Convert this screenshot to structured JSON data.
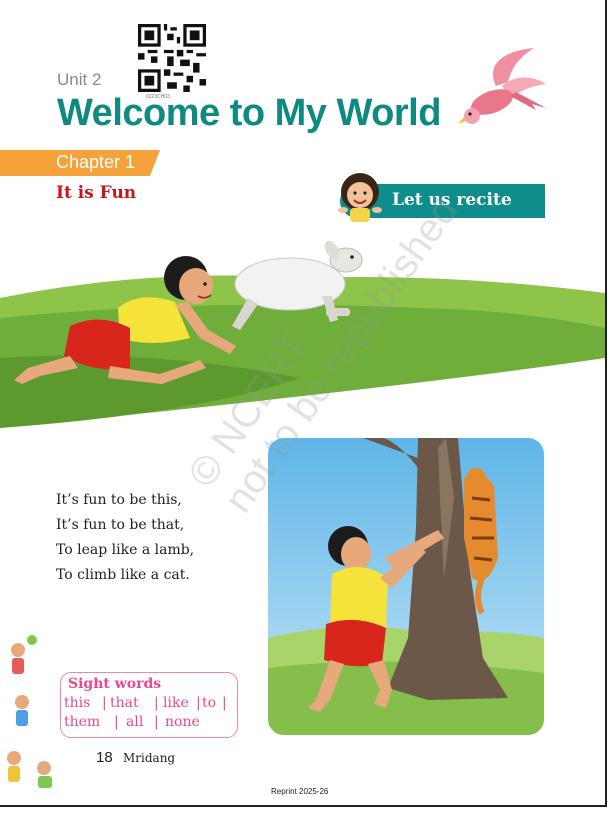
{
  "header": {
    "unit": "Unit 2",
    "qr_code_text": "0223CH03",
    "title": "Welcome to My World",
    "chapter": "Chapter 1",
    "subtitle": "It is Fun",
    "recite_label": "Let us recite"
  },
  "poem": {
    "lines": [
      "It’s fun to be this,",
      "It’s fun to be that,",
      "To leap like a lamb,",
      "To climb like a cat."
    ]
  },
  "sight_words": {
    "title": "Sight words",
    "row1": [
      "this",
      "that",
      "like",
      "to"
    ],
    "row2": [
      "them",
      "all",
      "none"
    ]
  },
  "watermark": {
    "line1": "© NCERT",
    "line2": "not to be republished"
  },
  "footer": {
    "page_number": "18",
    "book": "Mridang",
    "reprint": "Reprint 2025-26"
  },
  "colors": {
    "title": "#0e8a80",
    "chapter_banner": "#f5a23a",
    "subtitle": "#c4161c",
    "recite_tab": "#0f8d8d",
    "sight_words": "#e8488c"
  }
}
